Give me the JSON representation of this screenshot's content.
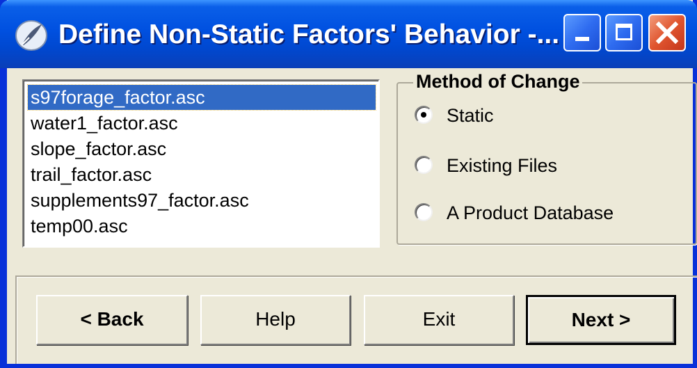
{
  "window": {
    "title": "Define Non-Static Factors' Behavior -..."
  },
  "titlebar_buttons": {
    "minimize": "minimize-icon",
    "maximize": "maximize-icon",
    "close": "close-icon"
  },
  "factor_list": {
    "items": [
      "s97forage_factor.asc",
      "water1_factor.asc",
      "slope_factor.asc",
      "trail_factor.asc",
      "supplements97_factor.asc",
      "temp00.asc"
    ],
    "selected_index": 0
  },
  "method_of_change": {
    "label": "Method of Change",
    "options": [
      "Static",
      "Existing Files",
      "A Product Database"
    ],
    "selected_index": 0
  },
  "buttons": {
    "back": "< Back",
    "help": "Help",
    "exit": "Exit",
    "next": "Next >"
  },
  "colors": {
    "titlebar": "#0050e0",
    "selection": "#316ac5",
    "face": "#ece9d8",
    "close_button": "#e0552f"
  }
}
